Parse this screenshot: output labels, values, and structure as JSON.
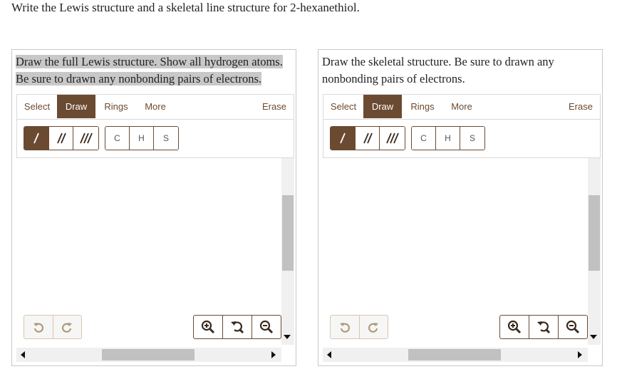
{
  "question": "Write the Lewis structure and a skeletal line structure for 2-hexanethiol.",
  "panels": [
    {
      "instruction_line1": "Draw the full Lewis structure. Show all hydrogen atoms.",
      "instruction_line2": "Be sure to drawn any nonbonding pairs of electrons.",
      "tabs": {
        "select": "Select",
        "draw": "Draw",
        "rings": "Rings",
        "more": "More",
        "erase": "Erase"
      },
      "atoms": [
        "C",
        "H",
        "S"
      ]
    },
    {
      "instruction_line1": "Draw the skeletal structure. Be sure to drawn any",
      "instruction_line2": "nonbonding pairs of electrons.",
      "tabs": {
        "select": "Select",
        "draw": "Draw",
        "rings": "Rings",
        "more": "More",
        "erase": "Erase"
      },
      "atoms": [
        "C",
        "H",
        "S"
      ]
    }
  ],
  "icons": {
    "single_bond": "single-bond-icon",
    "double_bond": "double-bond-icon",
    "triple_bond": "triple-bond-icon",
    "undo": "undo-icon",
    "redo": "redo-icon",
    "zoom_in": "zoom-in-icon",
    "zoom_reset": "zoom-reset-icon",
    "zoom_out": "zoom-out-icon"
  },
  "colors": {
    "accent": "#6b4a32",
    "highlight": "#c8c8c8"
  }
}
